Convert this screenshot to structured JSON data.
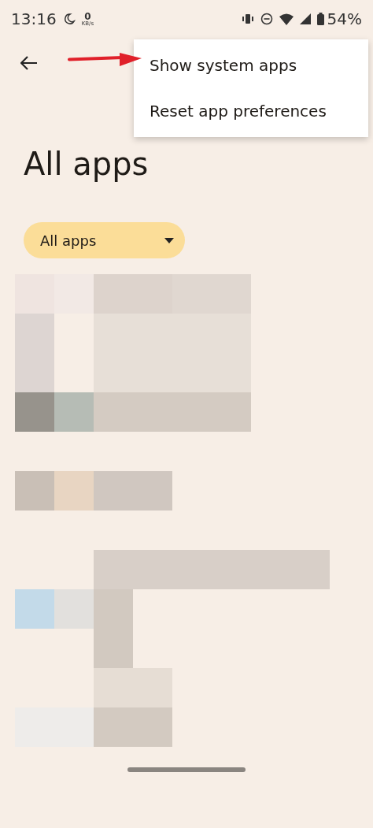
{
  "status_bar": {
    "time": "13:16",
    "net_speed": "0",
    "net_unit": "KB/s",
    "battery": "54%"
  },
  "overflow_menu": {
    "items": [
      {
        "label": "Show system apps"
      },
      {
        "label": "Reset app preferences"
      }
    ]
  },
  "title": "All apps",
  "filter": {
    "label": "All apps"
  }
}
